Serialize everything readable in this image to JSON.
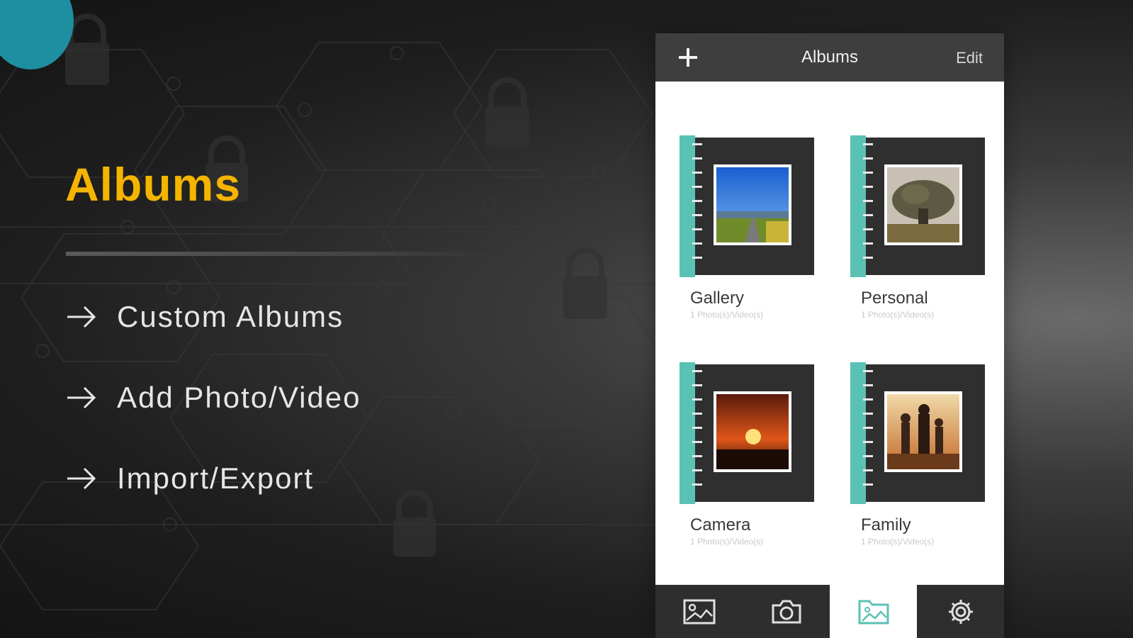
{
  "promo": {
    "title": "Albums",
    "features": [
      "Custom Albums",
      "Add Photo/Video",
      "Import/Export"
    ]
  },
  "nav": {
    "add_icon": "plus-icon",
    "title": "Albums",
    "edit_label": "Edit"
  },
  "albums": [
    {
      "name": "Gallery",
      "count": "1 Photo(s)/Video(s)"
    },
    {
      "name": "Personal",
      "count": "1 Photo(s)/Video(s)"
    },
    {
      "name": "Camera",
      "count": "1 Photo(s)/Video(s)"
    },
    {
      "name": "Family",
      "count": "1 Photo(s)/Video(s)"
    }
  ],
  "tabs": [
    {
      "icon": "photo-icon",
      "active": false
    },
    {
      "icon": "camera-icon",
      "active": false
    },
    {
      "icon": "albums-folder-icon",
      "active": true
    },
    {
      "icon": "gear-icon",
      "active": false
    }
  ],
  "colors": {
    "accent_title": "#f4b400",
    "spine_teal": "#5ac2b4",
    "circle_teal": "#1d8fa0"
  }
}
